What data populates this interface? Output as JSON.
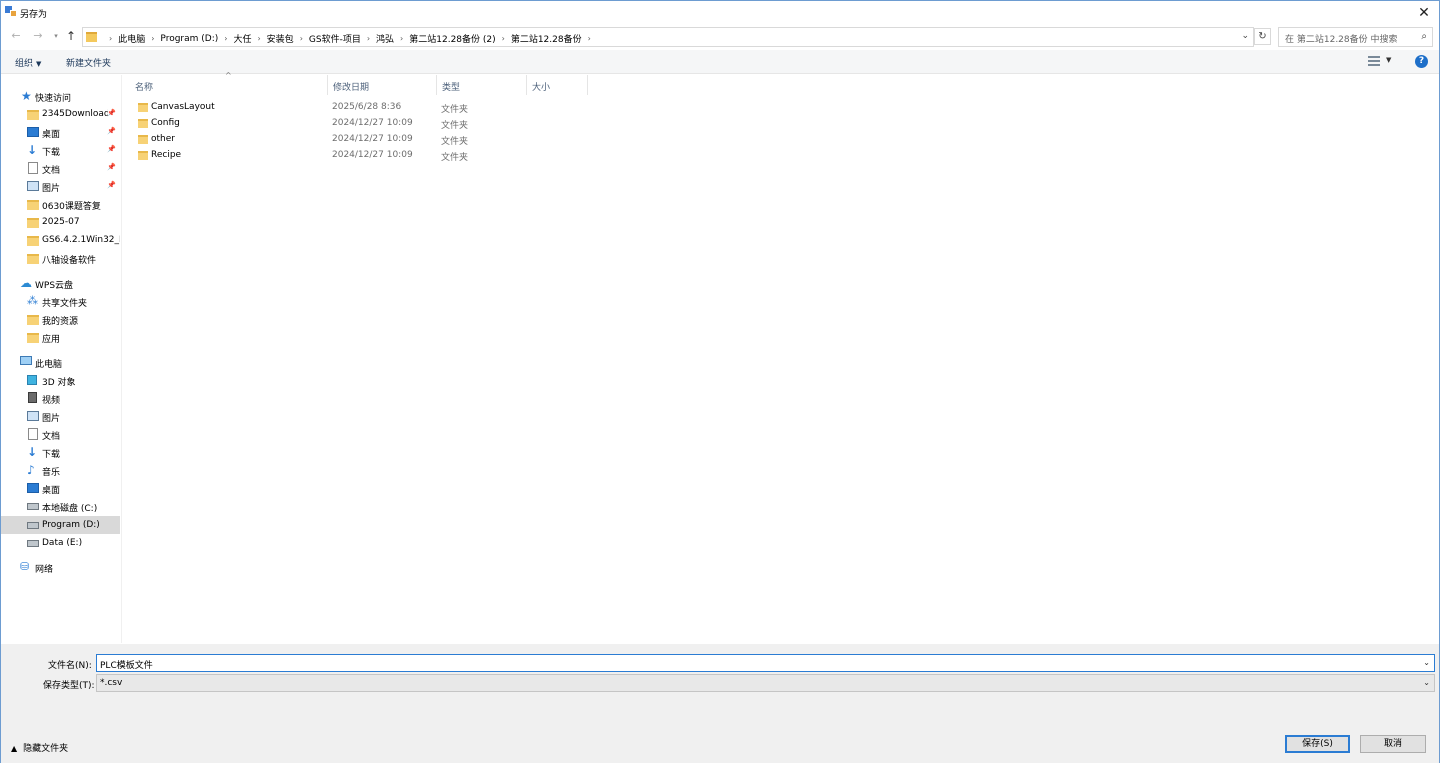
{
  "window": {
    "title": "另存为"
  },
  "address": {
    "crumbs": [
      "此电脑",
      "Program (D:)",
      "大任",
      "安装包",
      "GS软件-项目",
      "鸿弘",
      "第二站12.28备份 (2)",
      "第二站12.28备份"
    ],
    "search_placeholder": "在 第二站12.28备份 中搜索"
  },
  "toolbar": {
    "organize_label": "组织",
    "new_folder_label": "新建文件夹"
  },
  "nav": {
    "quick_access": {
      "label": "快速访问",
      "items": [
        {
          "label": "2345Download",
          "icon": "folder-icon",
          "pinned": true
        },
        {
          "label": "桌面",
          "icon": "desktop-icon",
          "pinned": true
        },
        {
          "label": "下载",
          "icon": "download-icon",
          "pinned": true
        },
        {
          "label": "文档",
          "icon": "document-icon",
          "pinned": true
        },
        {
          "label": "图片",
          "icon": "picture-icon",
          "pinned": true
        },
        {
          "label": "0630课题答复",
          "icon": "folder-icon",
          "pinned": false
        },
        {
          "label": "2025-07",
          "icon": "folder-icon",
          "pinned": false
        },
        {
          "label": "GS6.4.2.1Win32_E",
          "icon": "folder-icon",
          "pinned": false
        },
        {
          "label": "八轴设备软件",
          "icon": "folder-icon",
          "pinned": false
        }
      ]
    },
    "wps": {
      "label": "WPS云盘",
      "items": [
        {
          "label": "共享文件夹",
          "icon": "share-icon"
        },
        {
          "label": "我的资源",
          "icon": "folder-icon"
        },
        {
          "label": "应用",
          "icon": "folder-icon"
        }
      ]
    },
    "this_pc": {
      "label": "此电脑",
      "items": [
        {
          "label": "3D 对象",
          "icon": "3d-objects-icon"
        },
        {
          "label": "视频",
          "icon": "video-icon"
        },
        {
          "label": "图片",
          "icon": "picture-icon"
        },
        {
          "label": "文档",
          "icon": "document-icon"
        },
        {
          "label": "下载",
          "icon": "download-icon"
        },
        {
          "label": "音乐",
          "icon": "music-icon"
        },
        {
          "label": "桌面",
          "icon": "desktop-icon"
        },
        {
          "label": "本地磁盘 (C:)",
          "icon": "drive-icon"
        },
        {
          "label": "Program (D:)",
          "icon": "drive-icon",
          "selected": true
        },
        {
          "label": "Data (E:)",
          "icon": "drive-icon"
        }
      ]
    },
    "network": {
      "label": "网络"
    }
  },
  "filelist": {
    "columns": [
      "名称",
      "修改日期",
      "类型",
      "大小"
    ],
    "rows": [
      {
        "name": "CanvasLayout",
        "date": "2025/6/28 8:36",
        "type": "文件夹"
      },
      {
        "name": "Config",
        "date": "2024/12/27 10:09",
        "type": "文件夹"
      },
      {
        "name": "other",
        "date": "2024/12/27 10:09",
        "type": "文件夹"
      },
      {
        "name": "Recipe",
        "date": "2024/12/27 10:09",
        "type": "文件夹"
      }
    ]
  },
  "form": {
    "filename_label": "文件名(N):",
    "filename_value": "PLC模板文件",
    "filetype_label": "保存类型(T):",
    "filetype_value": "*.csv",
    "hide_folders_label": "隐藏文件夹",
    "save_label": "保存(S)",
    "cancel_label": "取消"
  },
  "colors": {
    "accent": "#2b7cd3",
    "folder": "#f7d276",
    "selected_bg": "#d9d9d9"
  }
}
